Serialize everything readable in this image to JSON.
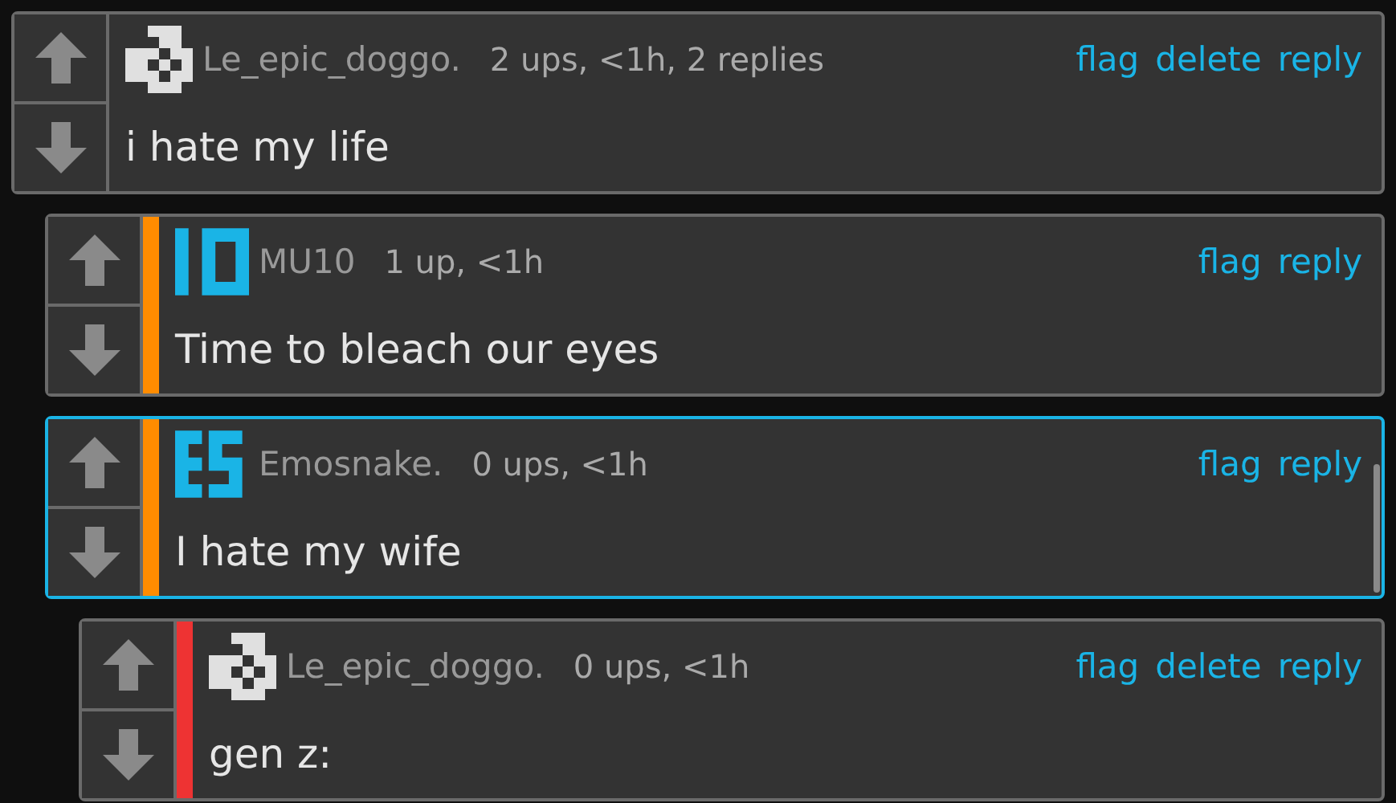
{
  "comments": [
    {
      "author": "Le_epic_doggo.",
      "avatar": {
        "kind": "checker"
      },
      "meta": "2 ups, <1h, 2 replies",
      "actions": [
        "flag",
        "delete",
        "reply"
      ],
      "text": "i hate my life",
      "selected": false,
      "children": [
        {
          "author": "MU10",
          "avatar": {
            "kind": "bars"
          },
          "meta": "1 up, <1h",
          "actions": [
            "flag",
            "reply"
          ],
          "text": "Time to bleach our eyes",
          "selected": false,
          "color": "#ff8c00"
        },
        {
          "author": "Emosnake.",
          "avatar": {
            "kind": "blocks"
          },
          "meta": "0 ups, <1h",
          "actions": [
            "flag",
            "reply"
          ],
          "text": "I hate my wife",
          "selected": true,
          "color": "#ff8c00",
          "children": [
            {
              "author": "Le_epic_doggo.",
              "avatar": {
                "kind": "checker"
              },
              "meta": "0 ups, <1h",
              "actions": [
                "flag",
                "delete",
                "reply"
              ],
              "text": "gen z:",
              "selected": false,
              "color": "#ee3333"
            }
          ]
        }
      ]
    }
  ]
}
